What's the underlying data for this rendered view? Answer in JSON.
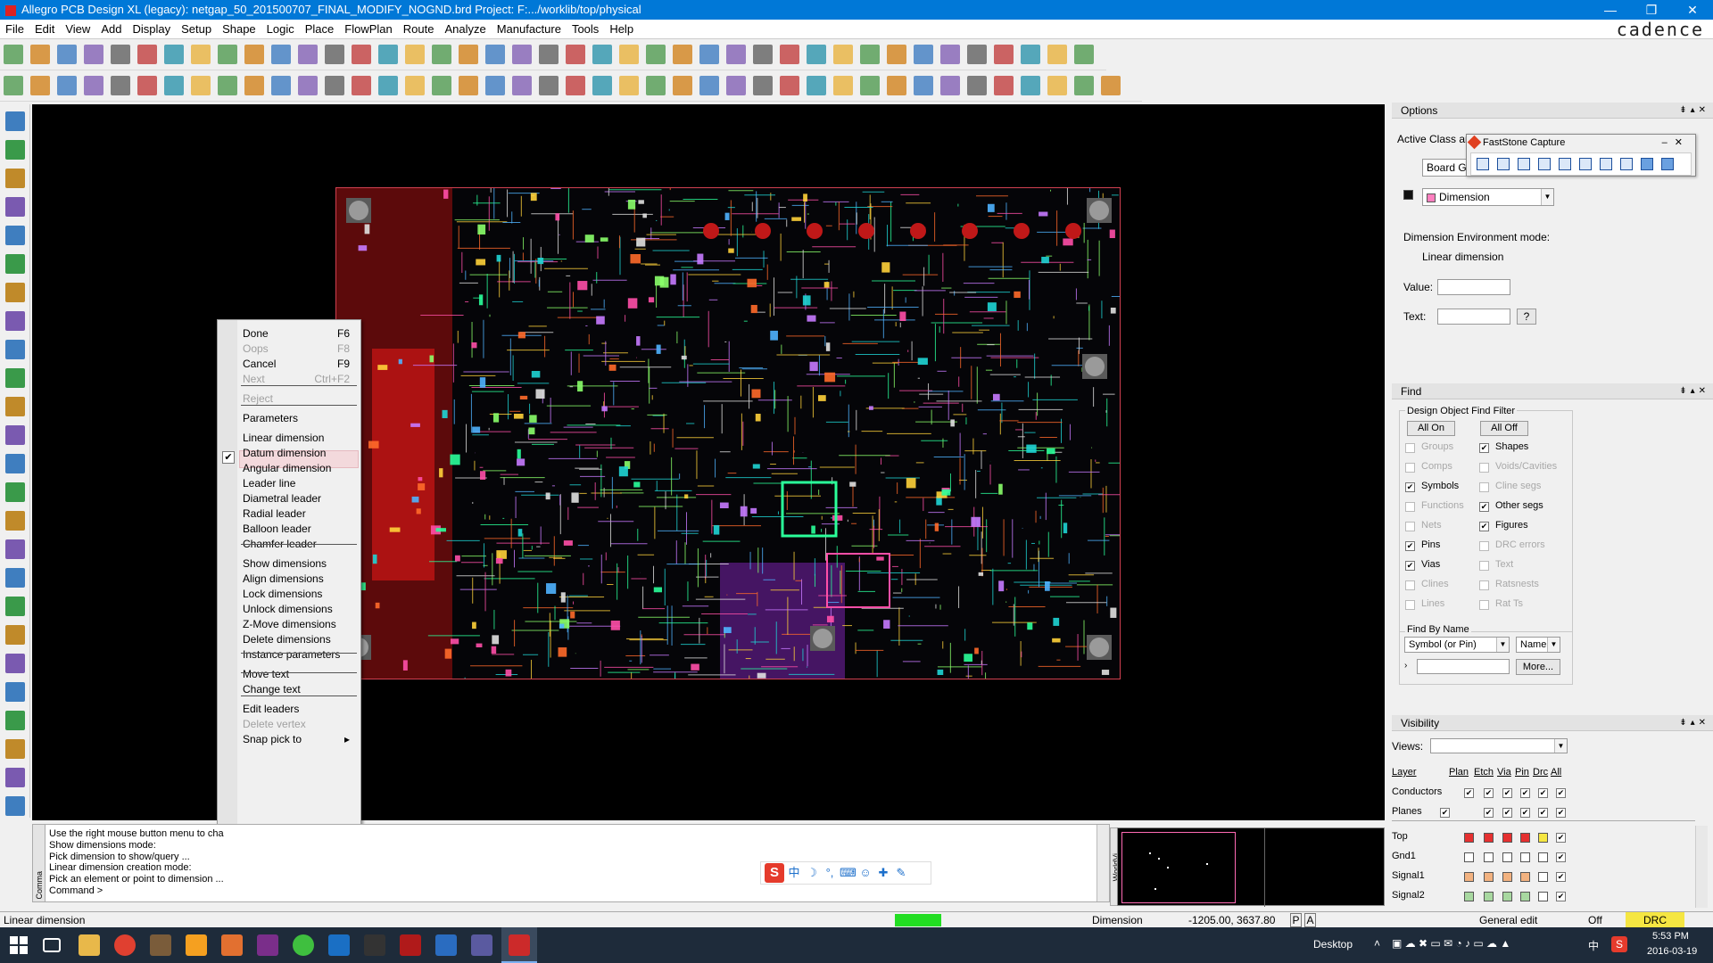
{
  "window": {
    "title": "Allegro PCB Design XL (legacy): netgap_50_201500707_FINAL_MODIFY_NOGND.brd  Project: F:.../worklib/top/physical",
    "brand": "cadence",
    "minimize": "—",
    "maximize": "❐",
    "close": "✕"
  },
  "menubar": [
    "File",
    "Edit",
    "View",
    "Add",
    "Display",
    "Setup",
    "Shape",
    "Logic",
    "Place",
    "FlowPlan",
    "Route",
    "Analyze",
    "Manufacture",
    "Tools",
    "Help"
  ],
  "context_menu": {
    "items": [
      {
        "label": "Done",
        "accel": "F6",
        "disabled": false
      },
      {
        "label": "Oops",
        "accel": "F8",
        "disabled": true
      },
      {
        "label": "Cancel",
        "accel": "F9",
        "disabled": false
      },
      {
        "label": "Next",
        "accel": "Ctrl+F2",
        "disabled": true
      },
      {
        "label": "Reject",
        "accel": "",
        "disabled": true
      },
      {
        "label": "Parameters",
        "accel": "",
        "disabled": false
      },
      {
        "label": "Linear dimension",
        "accel": "",
        "disabled": false,
        "checked": true
      },
      {
        "label": "Datum dimension",
        "accel": "",
        "disabled": false
      },
      {
        "label": "Angular dimension",
        "accel": "",
        "disabled": false
      },
      {
        "label": "Leader line",
        "accel": "",
        "disabled": false
      },
      {
        "label": "Diametral leader",
        "accel": "",
        "disabled": false
      },
      {
        "label": "Radial leader",
        "accel": "",
        "disabled": false
      },
      {
        "label": "Balloon leader",
        "accel": "",
        "disabled": false
      },
      {
        "label": "Chamfer leader",
        "accel": "",
        "disabled": false
      },
      {
        "label": "Show dimensions",
        "accel": "",
        "disabled": false
      },
      {
        "label": "Align dimensions",
        "accel": "",
        "disabled": false
      },
      {
        "label": "Lock dimensions",
        "accel": "",
        "disabled": false
      },
      {
        "label": "Unlock dimensions",
        "accel": "",
        "disabled": false
      },
      {
        "label": "Z-Move dimensions",
        "accel": "",
        "disabled": false
      },
      {
        "label": "Delete dimensions",
        "accel": "",
        "disabled": false
      },
      {
        "label": "Instance parameters",
        "accel": "",
        "disabled": false
      },
      {
        "label": "Move text",
        "accel": "",
        "disabled": false
      },
      {
        "label": "Change text",
        "accel": "",
        "disabled": false
      },
      {
        "label": "Edit leaders",
        "accel": "",
        "disabled": false
      },
      {
        "label": "Delete vertex",
        "accel": "",
        "disabled": true
      },
      {
        "label": "Snap pick to",
        "accel": "▸",
        "disabled": false
      }
    ]
  },
  "options": {
    "title": "Options",
    "active_class_label": "Active Class and",
    "class_value": "Board Ge",
    "subclass_value": "Dimension",
    "env_mode_label": "Dimension Environment mode:",
    "env_mode_value": "Linear dimension",
    "value_label": "Value:",
    "text_label": "Text:",
    "help_btn": "?"
  },
  "faststone": {
    "title": "FastStone Capture"
  },
  "find": {
    "title": "Find",
    "group_label": "Design Object Find Filter",
    "all_on": "All On",
    "all_off": "All Off",
    "left_items": [
      {
        "label": "Groups",
        "checked": false,
        "enabled": false
      },
      {
        "label": "Comps",
        "checked": false,
        "enabled": false
      },
      {
        "label": "Symbols",
        "checked": true,
        "enabled": true
      },
      {
        "label": "Functions",
        "checked": false,
        "enabled": false
      },
      {
        "label": "Nets",
        "checked": false,
        "enabled": false
      },
      {
        "label": "Pins",
        "checked": true,
        "enabled": true
      },
      {
        "label": "Vias",
        "checked": true,
        "enabled": true
      },
      {
        "label": "Clines",
        "checked": false,
        "enabled": false
      },
      {
        "label": "Lines",
        "checked": false,
        "enabled": false
      }
    ],
    "right_items": [
      {
        "label": "Shapes",
        "checked": true,
        "enabled": true
      },
      {
        "label": "Voids/Cavities",
        "checked": false,
        "enabled": false
      },
      {
        "label": "Cline segs",
        "checked": false,
        "enabled": false
      },
      {
        "label": "Other segs",
        "checked": true,
        "enabled": true
      },
      {
        "label": "Figures",
        "checked": true,
        "enabled": true
      },
      {
        "label": "DRC errors",
        "checked": false,
        "enabled": false
      },
      {
        "label": "Text",
        "checked": false,
        "enabled": false
      },
      {
        "label": "Ratsnests",
        "checked": false,
        "enabled": false
      },
      {
        "label": "Rat Ts",
        "checked": false,
        "enabled": false
      }
    ],
    "by_name_label": "Find By Name",
    "by_name_type": "Symbol (or Pin)",
    "by_name_field": "Name",
    "more_btn": "More..."
  },
  "visibility": {
    "title": "Visibility",
    "views_label": "Views:",
    "headers": [
      "Layer",
      "Plan",
      "Etch",
      "Via",
      "Pin",
      "Drc",
      "All"
    ],
    "conductors_label": "Conductors",
    "planes_label": "Planes",
    "layers": [
      {
        "name": "Top",
        "color": "#e53030"
      },
      {
        "name": "Gnd1",
        "color": "#ffffff"
      },
      {
        "name": "Signal1",
        "color": "#f2b280"
      },
      {
        "name": "Signal2",
        "color": "#a8d8a0"
      }
    ]
  },
  "command": {
    "lines": [
      "Use the right mouse button menu to cha",
      "Show dimensions mode:",
      "Pick dimension to show/query ...",
      "Linear dimension creation mode:",
      "Pick an element or point to dimension ...",
      "Command >"
    ],
    "side_label": "Comma"
  },
  "worldview": {
    "side_label": "WorldVi"
  },
  "status": {
    "mode": "Linear dimension",
    "subclass": "Dimension",
    "coords": "-1205.00, 3637.80",
    "p": "P",
    "a": "A",
    "edit_mode": "General edit",
    "off": "Off",
    "drc": "DRC",
    "status_color": "#22dd22",
    "drc_color": "#f5e642"
  },
  "taskbar": {
    "desktop": "Desktop",
    "lang": "中",
    "time": "5:53 PM",
    "date": "2016-03-19"
  }
}
